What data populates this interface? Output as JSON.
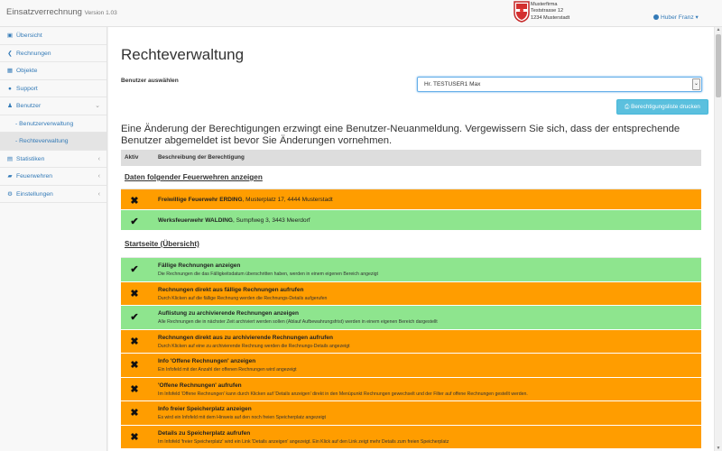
{
  "app": {
    "name": "Einsatzverrechnung",
    "version": "Version 1.03",
    "company": [
      "Musterfirma",
      "Teststrasse 12",
      "1234 Musterstadt"
    ],
    "user": "Huber Franz"
  },
  "sidebar": {
    "items": [
      {
        "label": "Übersicht",
        "icon": "home-icon",
        "glyph": "▣"
      },
      {
        "label": "Rechnungen",
        "icon": "chevron-left-icon",
        "glyph": "❮"
      },
      {
        "label": "Objekte",
        "icon": "building-icon",
        "glyph": "▦"
      },
      {
        "label": "Support",
        "icon": "support-icon",
        "glyph": "●"
      },
      {
        "label": "Benutzer",
        "icon": "users-icon",
        "glyph": "♟"
      },
      {
        "label": "- Benutzerverwaltung"
      },
      {
        "label": "- Rechteverwaltung"
      },
      {
        "label": "Statistiken",
        "icon": "chart-icon",
        "glyph": "▤"
      },
      {
        "label": "Feuerwehren",
        "icon": "firetruck-icon",
        "glyph": "▰"
      },
      {
        "label": "Einstellungen",
        "icon": "gear-icon",
        "glyph": "⚙"
      }
    ]
  },
  "page": {
    "title": "Rechteverwaltung",
    "select_label": "Benutzer auswählen",
    "selected_user": "Hr. TESTUSER1 Max",
    "print_button": "Berechtigungsliste drucken",
    "warning": "Eine Änderung der Berechtigungen erzwingt eine Benutzer-Neuanmeldung. Vergewissern Sie sich, dass der entsprechende Benutzer abgemeldet ist bevor Sie Änderungen vornehmen."
  },
  "table": {
    "headers": [
      "Aktiv",
      "Beschreibung der Berechtigung"
    ],
    "sections": [
      {
        "title": "Daten folgender Feuerwehren anzeigen",
        "rows": [
          {
            "active": false,
            "title": "Freiwillige Feuerwehr ERDING",
            "detail": ", Musterplatz 17, 4444 Musterstadt"
          },
          {
            "active": true,
            "title": "Werksfeuerwehr WALDING",
            "detail": ", Sumpfweg 3, 3443 Meerdorf"
          }
        ]
      },
      {
        "title": "Startseite (Übersicht)",
        "rows": [
          {
            "active": true,
            "title": "Fällige Rechnungen anzeigen",
            "desc": "Die Rechnungen die das Fälligkeitsdatum überschritten haben, werden in einem eigenen Bereich angezigt"
          },
          {
            "active": false,
            "title": "Rechnungen direkt aus fällige Rechnungen aufrufen",
            "desc": "Durch Klicken auf die fällige Rechnung werden die Rechnungs-Details aufgerufen"
          },
          {
            "active": true,
            "title": "Auflistung zu archivierende Rechnungen anzeigen",
            "desc": "Alle Rechnungen die in nächster Zeit archiviert werden sollen (Ablauf Aufbewahrungsfrist) werden in einem eigenen Bereich dargestellt"
          },
          {
            "active": false,
            "title": "Rechnungen direkt aus zu archivierende Rechnungen aufrufen",
            "desc": "Durch Klicken auf eine zu archivierende Rechnung werden die Rechnungs-Details angezeigt"
          },
          {
            "active": false,
            "title": "Info 'Offene Rechnungen' anzeigen",
            "desc": "Ein Infofeld mit der Anzahl der offenen Rechnungen wird angezeigt"
          },
          {
            "active": false,
            "title": "'Offene Rechnungen' aufrufen",
            "desc": "Im Infofeld 'Offene Rechnungen' kann durch Klicken auf 'Details anzeigen' direkt in den Menüpunkt Rechnungen gewechselt und der Filter auf offene Rechnungen gestellt werden."
          },
          {
            "active": false,
            "title": "Info freier Speicherplatz anzeigen",
            "desc": "Es wird ein Infofeld mit dem Hinweis auf den noch freien Speicherplatz angezeigt"
          },
          {
            "active": false,
            "title": "Details zu Speicherplatz aufrufen",
            "desc": "Im Infofeld 'freier Speicherplatz' wird ein Link 'Details anzeigen' angezeigt. Ein Klick auf den Link zeigt mehr Details zum freien Speicherplatz"
          }
        ]
      }
    ]
  },
  "colors": {
    "active_row": "#8ee58e",
    "inactive_row": "#ff9d00",
    "link": "#337ab7",
    "print_button": "#5bc0de"
  }
}
